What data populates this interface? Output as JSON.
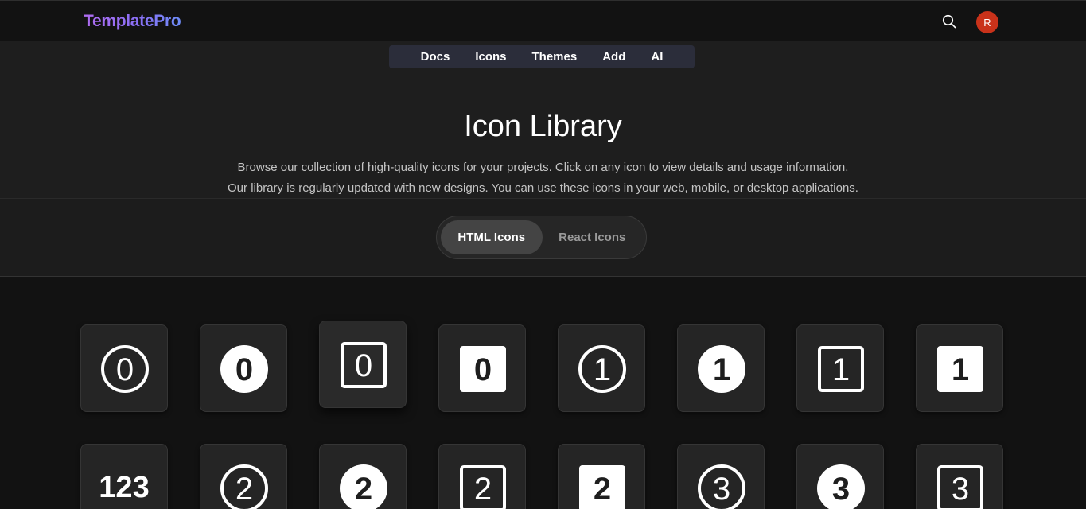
{
  "header": {
    "logo": "TemplatePro",
    "avatar_initial": "R"
  },
  "nav": {
    "items": [
      "Docs",
      "Icons",
      "Themes",
      "Add",
      "AI"
    ]
  },
  "hero": {
    "title": "Icon Library",
    "description": "Browse our collection of high-quality icons for your projects. Click on any icon to view details and usage information. Our library is regularly updated with new designs. You can use these icons in your web, mobile, or desktop applications."
  },
  "tabs": {
    "html": "HTML Icons",
    "react": "React Icons",
    "active": "HTML Icons"
  },
  "icons": [
    {
      "name": "0-circle-icon",
      "digit": "0",
      "style": "circle"
    },
    {
      "name": "0-circle-fill-icon",
      "digit": "0",
      "style": "circle-fill"
    },
    {
      "name": "0-square-icon",
      "digit": "0",
      "style": "square"
    },
    {
      "name": "0-square-fill-icon",
      "digit": "0",
      "style": "square-fill"
    },
    {
      "name": "1-circle-icon",
      "digit": "1",
      "style": "circle"
    },
    {
      "name": "1-circle-fill-icon",
      "digit": "1",
      "style": "circle-fill"
    },
    {
      "name": "1-square-icon",
      "digit": "1",
      "style": "square"
    },
    {
      "name": "1-square-fill-icon",
      "digit": "1",
      "style": "square-fill"
    },
    {
      "name": "123-icon",
      "digit": "123",
      "style": "plain"
    },
    {
      "name": "2-circle-icon",
      "digit": "2",
      "style": "circle"
    },
    {
      "name": "2-circle-fill-icon",
      "digit": "2",
      "style": "circle-fill"
    },
    {
      "name": "2-square-icon",
      "digit": "2",
      "style": "square"
    },
    {
      "name": "2-square-fill-icon",
      "digit": "2",
      "style": "square-fill"
    },
    {
      "name": "3-circle-icon",
      "digit": "3",
      "style": "circle"
    },
    {
      "name": "3-circle-fill-icon",
      "digit": "3",
      "style": "circle-fill"
    },
    {
      "name": "3-square-icon",
      "digit": "3",
      "style": "square"
    }
  ],
  "colors": {
    "accent_avatar": "#c9321a",
    "logo_gradient_start": "#b06cf0",
    "logo_gradient_end": "#6f8cf7"
  }
}
